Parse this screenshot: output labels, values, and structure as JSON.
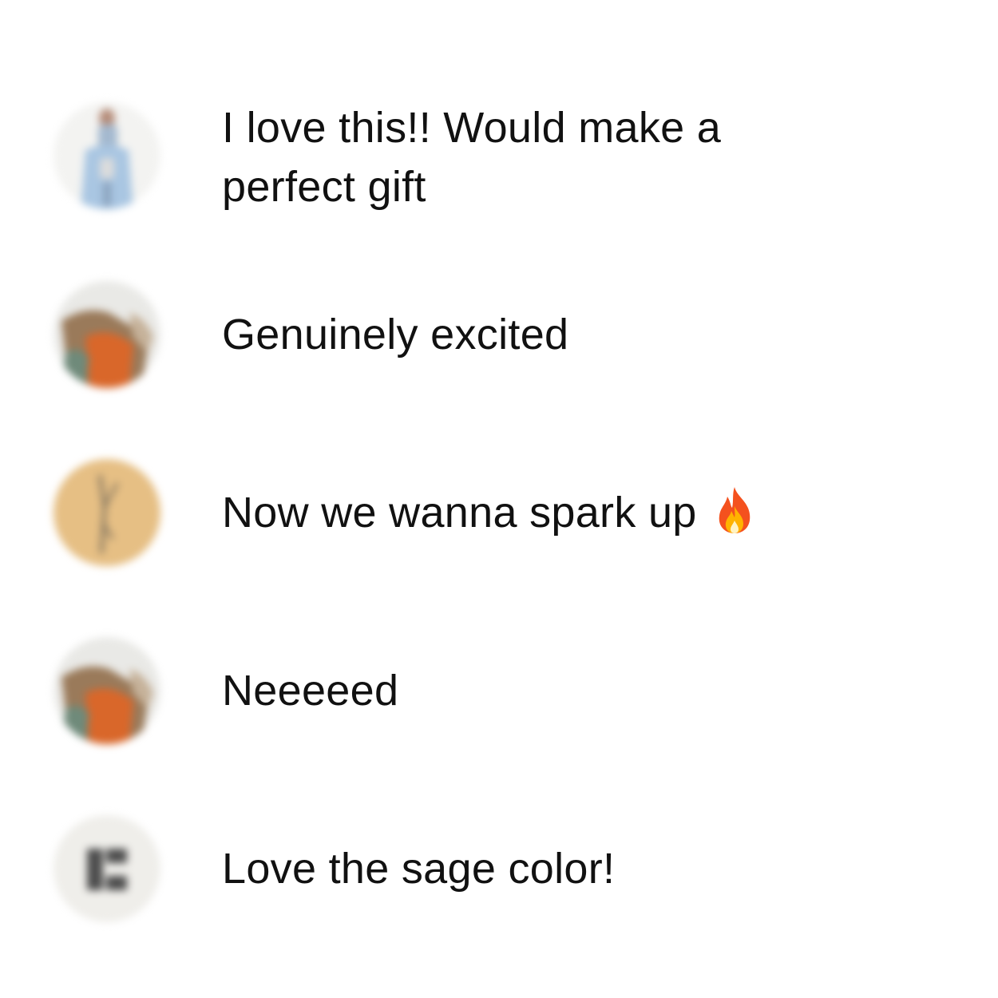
{
  "comments": [
    {
      "avatar": "person-in-light-blue-shirt",
      "text": "I love this!! Would make a perfect gift"
    },
    {
      "avatar": "orange-and-tan-photo",
      "text": "Genuinely excited"
    },
    {
      "avatar": "tan-circle-with-sketch",
      "text": "Now we wanna spark up",
      "emoji": "fire-icon"
    },
    {
      "avatar": "orange-and-tan-photo",
      "text": "Neeeeed"
    },
    {
      "avatar": "grey-letter-c-logo",
      "text": "Love the sage color!"
    }
  ],
  "colors": {
    "text": "#111111",
    "background": "#ffffff",
    "avatar_tan": "#e6bf84",
    "avatar_grey_bg": "#efeeea",
    "avatar_orange": "#d9672a"
  }
}
